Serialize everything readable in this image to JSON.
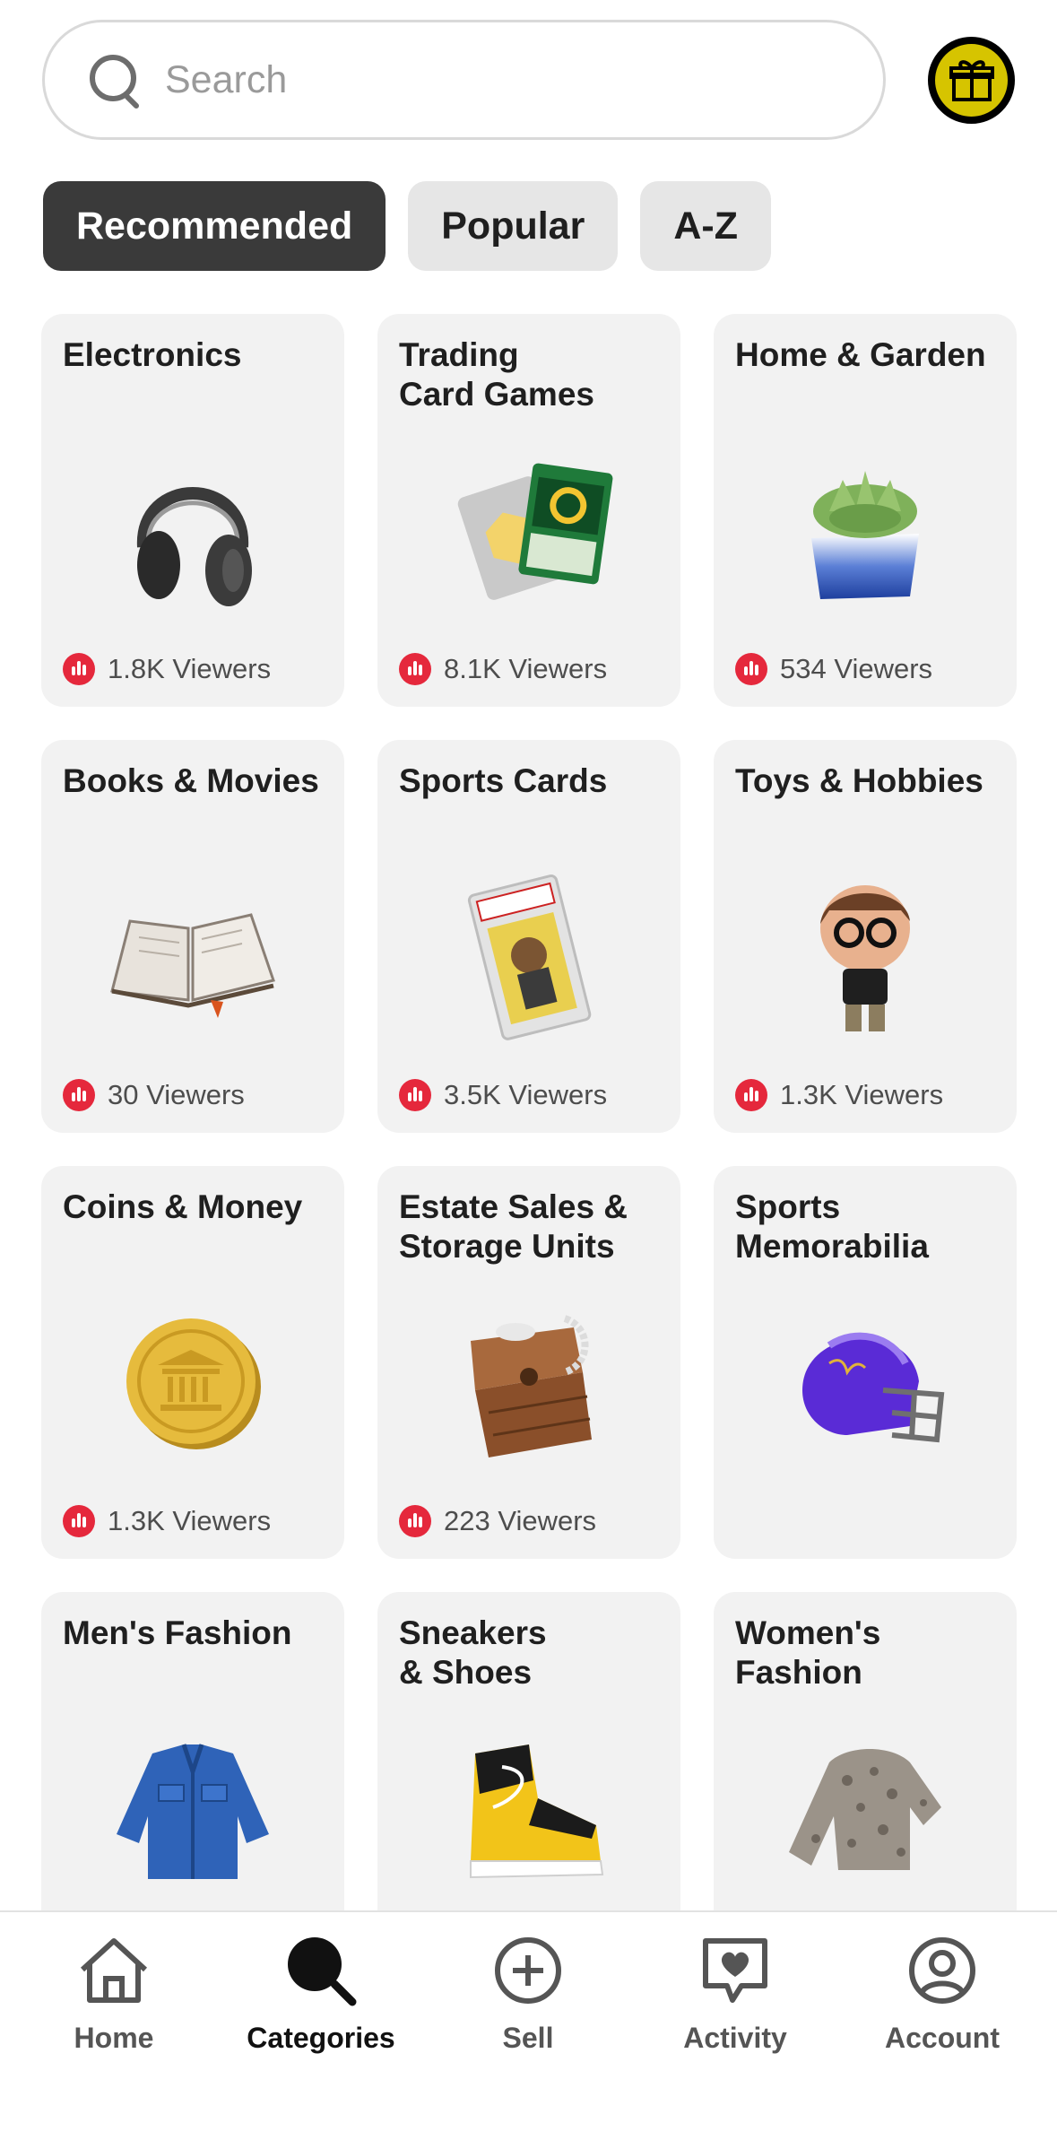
{
  "search": {
    "placeholder": "Search"
  },
  "filters": [
    {
      "label": "Recommended",
      "active": true
    },
    {
      "label": "Popular",
      "active": false
    },
    {
      "label": "A-Z",
      "active": false
    }
  ],
  "categories": [
    {
      "title": "Electronics",
      "viewers": "1.8K Viewers",
      "icon": "headphones-icon"
    },
    {
      "title": "Trading\nCard Games",
      "viewers": "8.1K Viewers",
      "icon": "trading-cards-icon"
    },
    {
      "title": "Home & Garden",
      "viewers": "534 Viewers",
      "icon": "plant-pot-icon"
    },
    {
      "title": "Books & Movies",
      "viewers": "30 Viewers",
      "icon": "book-icon"
    },
    {
      "title": "Sports Cards",
      "viewers": "3.5K Viewers",
      "icon": "graded-card-icon"
    },
    {
      "title": "Toys & Hobbies",
      "viewers": "1.3K Viewers",
      "icon": "figure-icon"
    },
    {
      "title": "Coins & Money",
      "viewers": "1.3K Viewers",
      "icon": "coin-icon"
    },
    {
      "title": "Estate Sales &\nStorage Units",
      "viewers": "223 Viewers",
      "icon": "trunk-icon"
    },
    {
      "title": "Sports\nMemorabilia",
      "viewers": "",
      "icon": "helmet-icon"
    },
    {
      "title": "Men's Fashion",
      "viewers": "",
      "icon": "denim-jacket-icon"
    },
    {
      "title": "Sneakers\n& Shoes",
      "viewers": "",
      "icon": "sneaker-icon"
    },
    {
      "title": "Women's\nFashion",
      "viewers": "",
      "icon": "sweater-icon"
    }
  ],
  "nav": [
    {
      "label": "Home",
      "icon": "home-icon",
      "active": false
    },
    {
      "label": "Categories",
      "icon": "categories-search-icon",
      "active": true
    },
    {
      "label": "Sell",
      "icon": "plus-circle-icon",
      "active": false
    },
    {
      "label": "Activity",
      "icon": "heart-chat-icon",
      "active": false
    },
    {
      "label": "Account",
      "icon": "account-icon",
      "active": false
    }
  ],
  "colors": {
    "accent_live": "#e5283c",
    "chip_active": "#3a3a3a",
    "gift_yellow": "#d6c400"
  }
}
